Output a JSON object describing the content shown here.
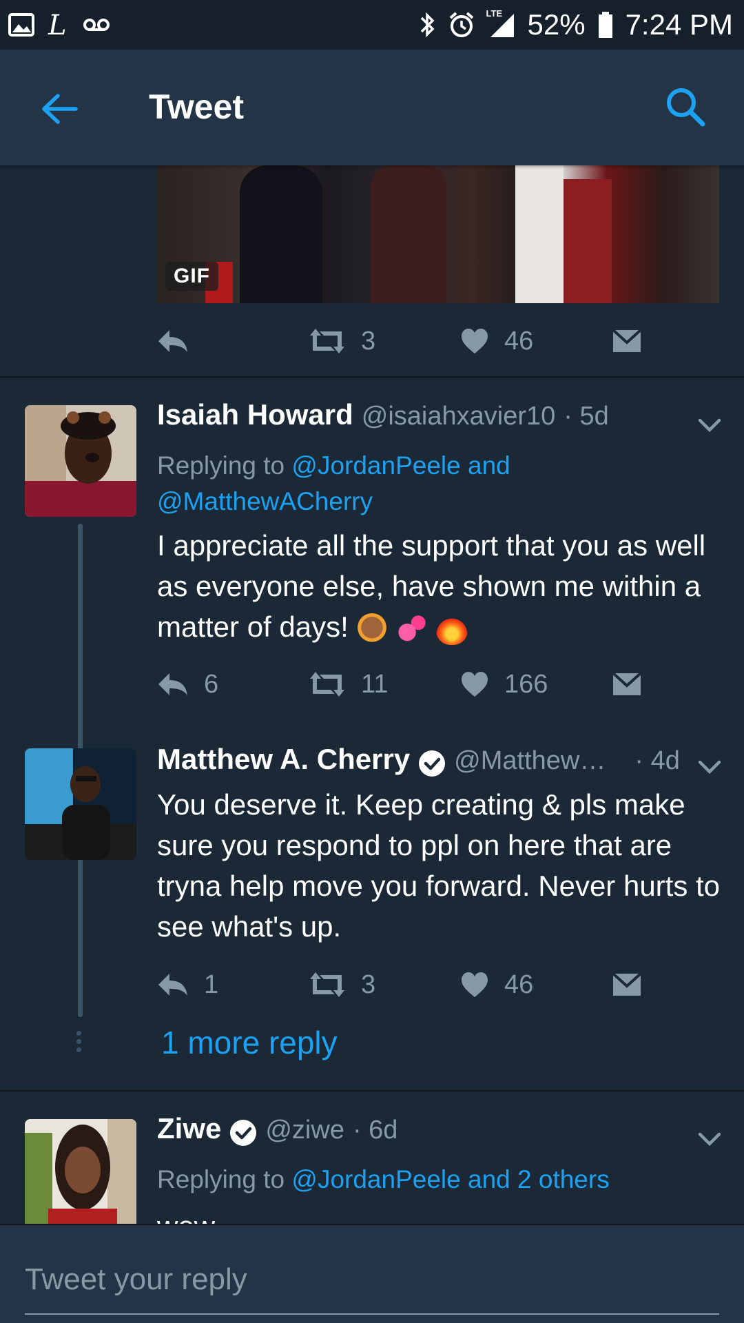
{
  "status_bar": {
    "icons_left": [
      "image-icon",
      "lastpass-icon",
      "voicemail-icon"
    ],
    "icons_right": [
      "bluetooth-icon",
      "alarm-icon",
      "lte-signal-icon",
      "battery-icon"
    ],
    "lte_label": "LTE",
    "battery": "52%",
    "time": "7:24 PM"
  },
  "app_bar": {
    "title": "Tweet"
  },
  "gif_tweet": {
    "badge": "GIF",
    "replies": "",
    "retweets": "3",
    "likes": "46"
  },
  "replies": [
    {
      "name": "Isaiah Howard",
      "handle": "@isaiahxavier10",
      "time": "· 5d",
      "replying_prefix": "Replying to",
      "replying_to": "@JordanPeele and @MatthewACherry",
      "text": "I appreciate all the support that you as well as everyone else, have shown me within a matter of days!",
      "emojis": [
        "raising-hands-emoji",
        "two-hearts-emoji",
        "fire-emoji"
      ],
      "replies": "6",
      "retweets": "11",
      "likes": "166"
    },
    {
      "name": "Matthew A. Cherry",
      "handle": "@Matthew…",
      "time": "· 4d",
      "verified": true,
      "text": "You deserve it. Keep creating & pls make sure you respond to ppl on here that are tryna help move you forward. Never hurts to see what's up.",
      "replies": "1",
      "retweets": "3",
      "likes": "46"
    }
  ],
  "more_replies": "1 more reply",
  "next_tweet": {
    "name": "Ziwe",
    "handle": "@ziwe",
    "time": "· 6d",
    "verified": true,
    "replying_prefix": "Replying to",
    "replying_to": "@JordanPeele and 2 others",
    "text": "wow"
  },
  "composer": {
    "placeholder": "Tweet your reply"
  },
  "colors": {
    "background": "#1b2836",
    "bar": "#243447",
    "accent": "#1da1f2",
    "muted": "#8899a6"
  }
}
